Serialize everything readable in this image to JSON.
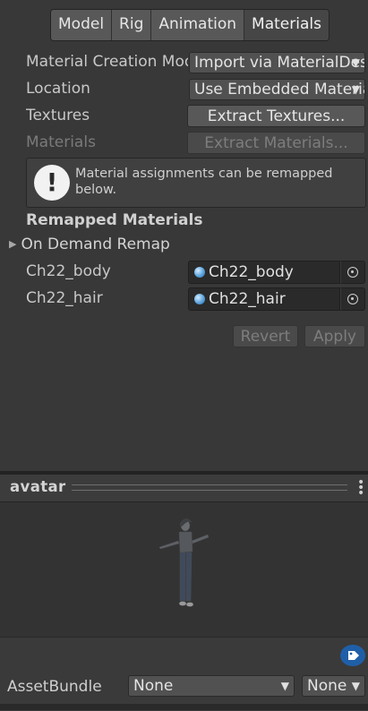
{
  "tabs": [
    "Model",
    "Rig",
    "Animation",
    "Materials"
  ],
  "active_tab": "Materials",
  "fields": {
    "material_creation": {
      "label": "Material Creation Mode",
      "value": "Import via MaterialDescription"
    },
    "location": {
      "label": "Location",
      "value": "Use Embedded Materials"
    },
    "textures": {
      "label": "Textures",
      "button": "Extract Textures..."
    },
    "materials": {
      "label": "Materials",
      "button": "Extract Materials..."
    }
  },
  "help": {
    "text": "Material assignments can be remapped below."
  },
  "remapped": {
    "title": "Remapped Materials",
    "foldout": "On Demand Remap",
    "items": [
      {
        "label": "Ch22_body",
        "value": "Ch22_body"
      },
      {
        "label": "Ch22_hair",
        "value": "Ch22_hair"
      }
    ]
  },
  "actions": {
    "revert": "Revert",
    "apply": "Apply"
  },
  "preview": {
    "title": "avatar"
  },
  "assetbundle": {
    "label": "AssetBundle",
    "name": "None",
    "variant": "None"
  },
  "icons": {
    "dropdown": "triangle-down-icon",
    "help": "exclamation-icon",
    "material": "material-sphere-icon",
    "picker": "object-picker-icon",
    "menu": "kebab-menu-icon",
    "tag": "label-tag-icon",
    "foldout": "triangle-right-icon"
  },
  "colors": {
    "background": "#383838",
    "field": "#2a2a2a",
    "accent": "#1f5fa8"
  }
}
